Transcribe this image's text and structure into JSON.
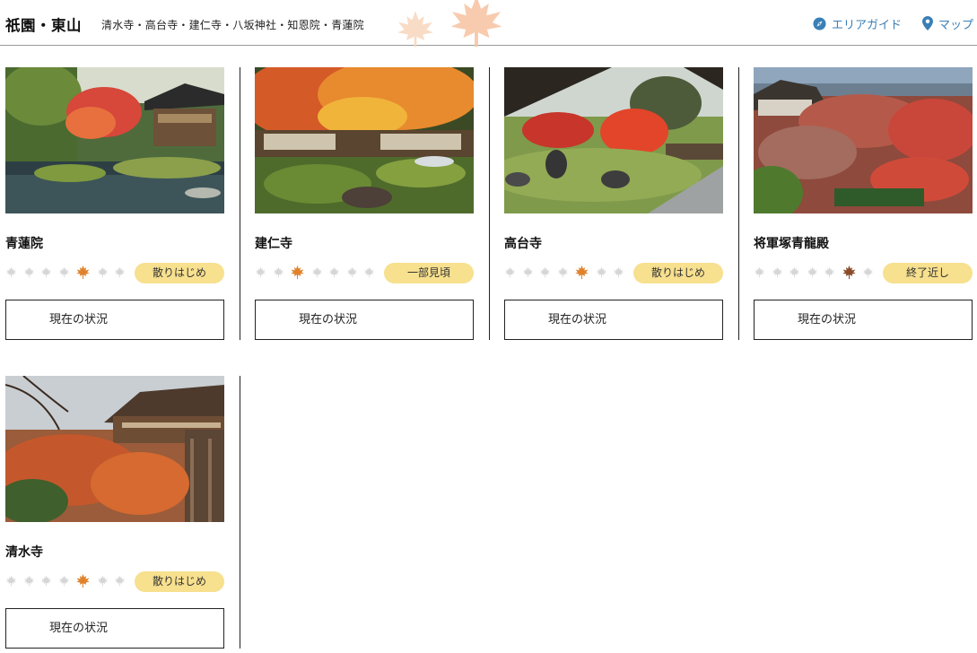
{
  "header": {
    "title": "祇園・東山",
    "subtitle": "清水寺・高台寺・建仁寺・八坂神社・知恩院・青蓮院",
    "area_guide_label": "エリアガイド",
    "map_label": "マップ",
    "icons": {
      "area_guide": "compass-icon",
      "map": "map-pin-icon"
    },
    "link_color": "#3a7fb6"
  },
  "status_scale": {
    "total_levels": 7
  },
  "spots": [
    {
      "name": "青蓮院",
      "level": 5,
      "status": "散りはじめ",
      "button_label": "現在の状況"
    },
    {
      "name": "建仁寺",
      "level": 3,
      "status": "一部見頃",
      "button_label": "現在の状況"
    },
    {
      "name": "高台寺",
      "level": 5,
      "status": "散りはじめ",
      "button_label": "現在の状況"
    },
    {
      "name": "将軍塚青龍殿",
      "level": 6,
      "status": "終了近し",
      "button_label": "現在の状況"
    },
    {
      "name": "清水寺",
      "level": 5,
      "status": "散りはじめ",
      "button_label": "現在の状況"
    }
  ],
  "colors": {
    "badge_bg": "#f7e08e",
    "leaf_inactive": "#d6d6d6",
    "leaf_orange": "#e0822b",
    "leaf_brown": "#8a4b2a"
  }
}
